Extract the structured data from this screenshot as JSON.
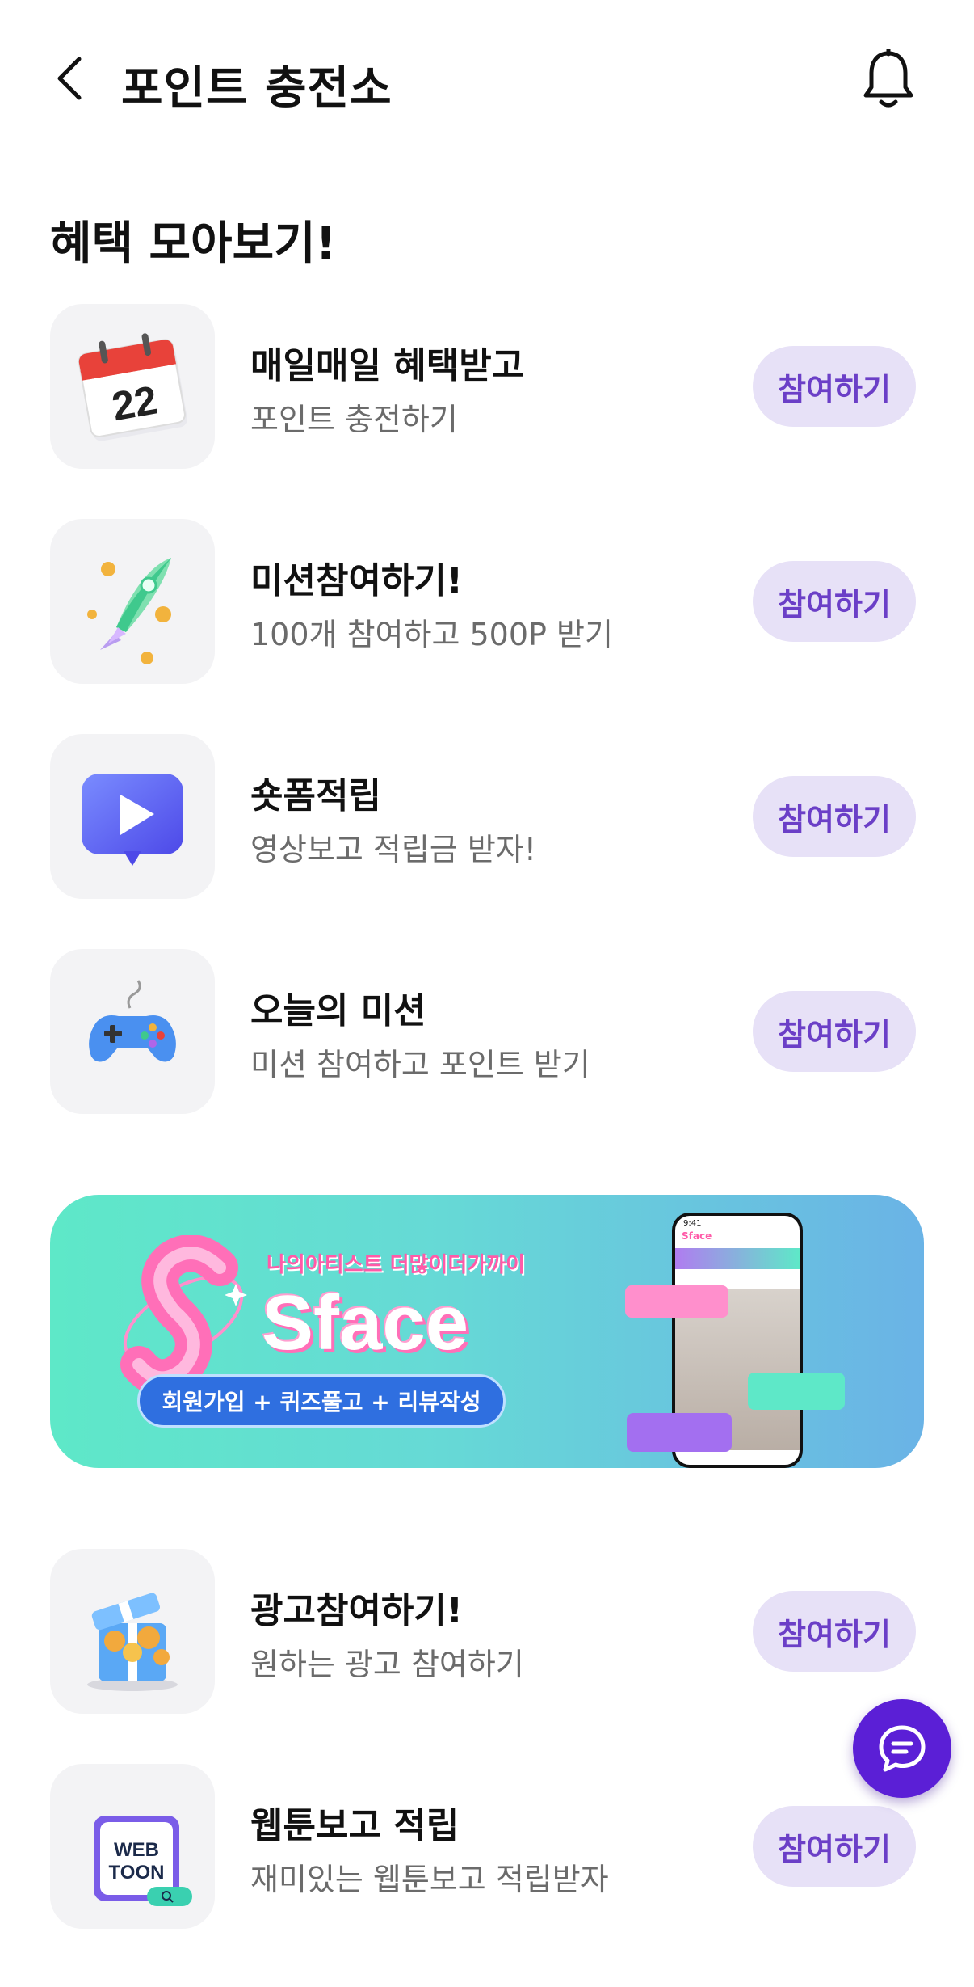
{
  "header": {
    "title": "포인트 충전소"
  },
  "section": {
    "title": "혜택 모아보기!"
  },
  "items": [
    {
      "title": "매일매일 혜택받고",
      "subtitle": "포인트 충전하기",
      "button": "참여하기",
      "icon": "calendar-icon"
    },
    {
      "title": "미션참여하기!",
      "subtitle": "100개 참여하고 500P 받기",
      "button": "참여하기",
      "icon": "rocket-icon"
    },
    {
      "title": "숏폼적립",
      "subtitle": "영상보고 적립금 받자!",
      "button": "참여하기",
      "icon": "play-video-icon"
    },
    {
      "title": "오늘의 미션",
      "subtitle": "미션 참여하고 포인트 받기",
      "button": "참여하기",
      "icon": "gamepad-icon"
    },
    {
      "title": "광고참여하기!",
      "subtitle": "원하는 광고 참여하기",
      "button": "참여하기",
      "icon": "gift-box-icon"
    },
    {
      "title": "웹툰보고 적립",
      "subtitle": "재미있는 웹툰보고 적립받자",
      "button": "참여하기",
      "icon": "webtoon-icon"
    }
  ],
  "calendar_day": "22",
  "webtoon_badge": "WEB\nTOON",
  "banner": {
    "tagline": "나의아티스트 더많이더가까이",
    "brand": "Sface",
    "pill": "회원가입 + 퀴즈풀고 + 리뷰작성",
    "phone_time": "9:41",
    "phone_logo": "Sface"
  },
  "colors": {
    "accent": "#5b1fd6",
    "button_bg": "#e7e1f7",
    "button_text": "#6b3fc7",
    "thumb_bg": "#f3f3f5"
  }
}
